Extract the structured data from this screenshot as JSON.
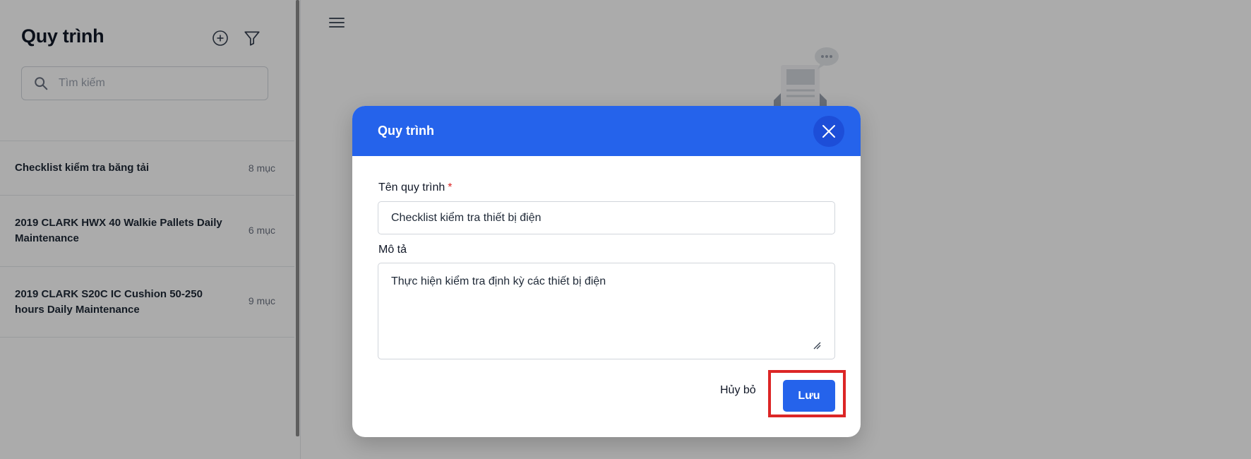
{
  "sidebar": {
    "title": "Quy trình",
    "search_placeholder": "Tìm kiếm",
    "items": [
      {
        "name": "Checklist kiểm tra băng tải",
        "count": "8 mục"
      },
      {
        "name": "2019 CLARK HWX 40 Walkie Pallets Daily Maintenance",
        "count": "6 mục"
      },
      {
        "name": "2019 CLARK S20C IC Cushion 50-250 hours Daily Maintenance",
        "count": "9 mục"
      }
    ]
  },
  "icons": {
    "add": "plus-circle-icon",
    "filter": "filter-icon",
    "search": "search-icon",
    "menu": "hamburger-menu-icon",
    "close": "close-icon"
  },
  "modal": {
    "title": "Quy trình",
    "name_label": "Tên quy trình",
    "required_mark": "*",
    "name_value": "Checklist kiểm tra thiết bị điện",
    "description_label": "Mô tả",
    "description_value": "Thực hiện kiểm tra định kỳ các thiết bị điện",
    "cancel_label": "Hủy bỏ",
    "save_label": "Lưu"
  },
  "colors": {
    "primary": "#2563eb",
    "required": "#dc2626",
    "highlight": "#dc2626"
  }
}
